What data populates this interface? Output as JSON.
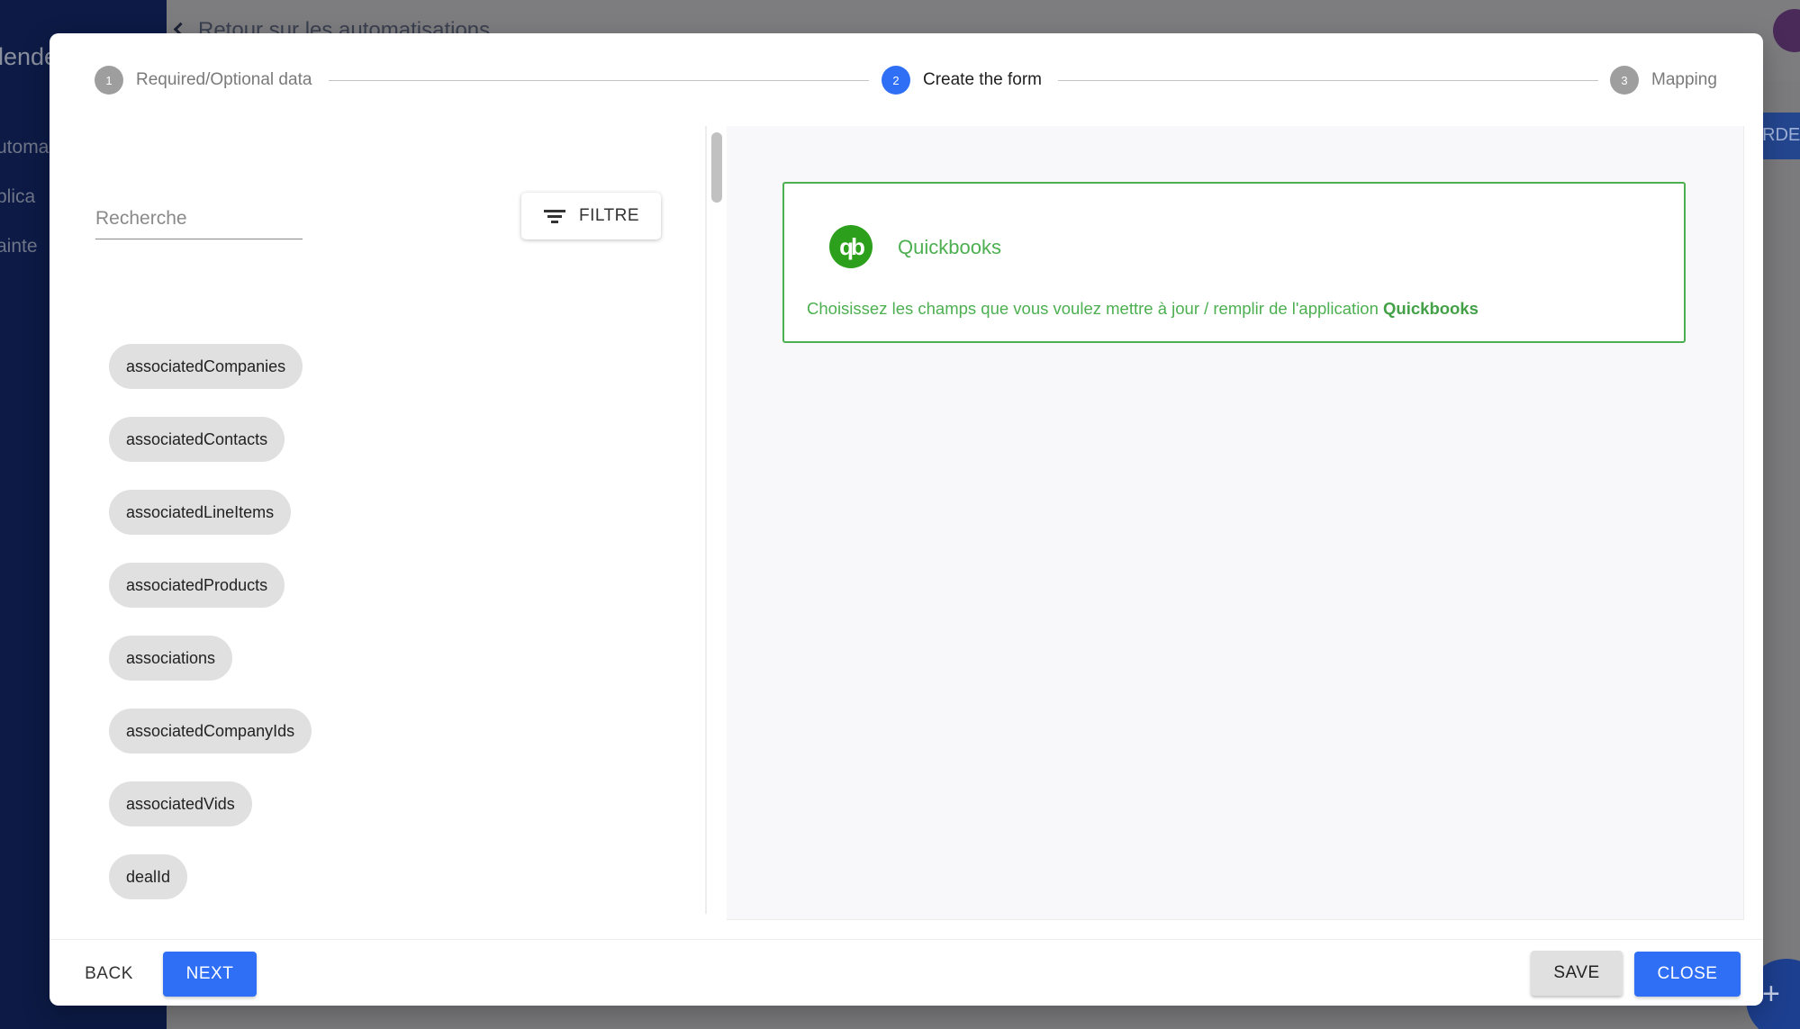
{
  "background": {
    "brand": "lende",
    "nav": [
      "utoma",
      "plica",
      "ainte"
    ],
    "back_link": "Retour sur les automatisations",
    "order_button": "RDER",
    "fab_icon": "plus-icon"
  },
  "stepper": {
    "steps": [
      {
        "number": "1",
        "label": "Required/Optional data",
        "state": "inactive"
      },
      {
        "number": "2",
        "label": "Create the form",
        "state": "active"
      },
      {
        "number": "3",
        "label": "Mapping",
        "state": "inactive"
      }
    ],
    "active_color": "#2f6ff5",
    "inactive_color": "#9e9e9e"
  },
  "search": {
    "placeholder": "Recherche",
    "value": ""
  },
  "filter_button": {
    "label": "FILTRE",
    "icon": "filter-list-icon"
  },
  "fields": [
    "associatedCompanies",
    "associatedContacts",
    "associatedLineItems",
    "associatedProducts",
    "associations",
    "associatedCompanyIds",
    "associatedVids",
    "dealId"
  ],
  "app_card": {
    "name": "Quickbooks",
    "logo_text": "qb",
    "description": "Choisissez les champs que vous voulez mettre à jour / remplir de l'application",
    "description_app": "Quickbooks",
    "accent_color": "#4caf50"
  },
  "footer": {
    "back_label": "BACK",
    "next_label": "NEXT",
    "save_label": "SAVE",
    "close_label": "CLOSE"
  }
}
